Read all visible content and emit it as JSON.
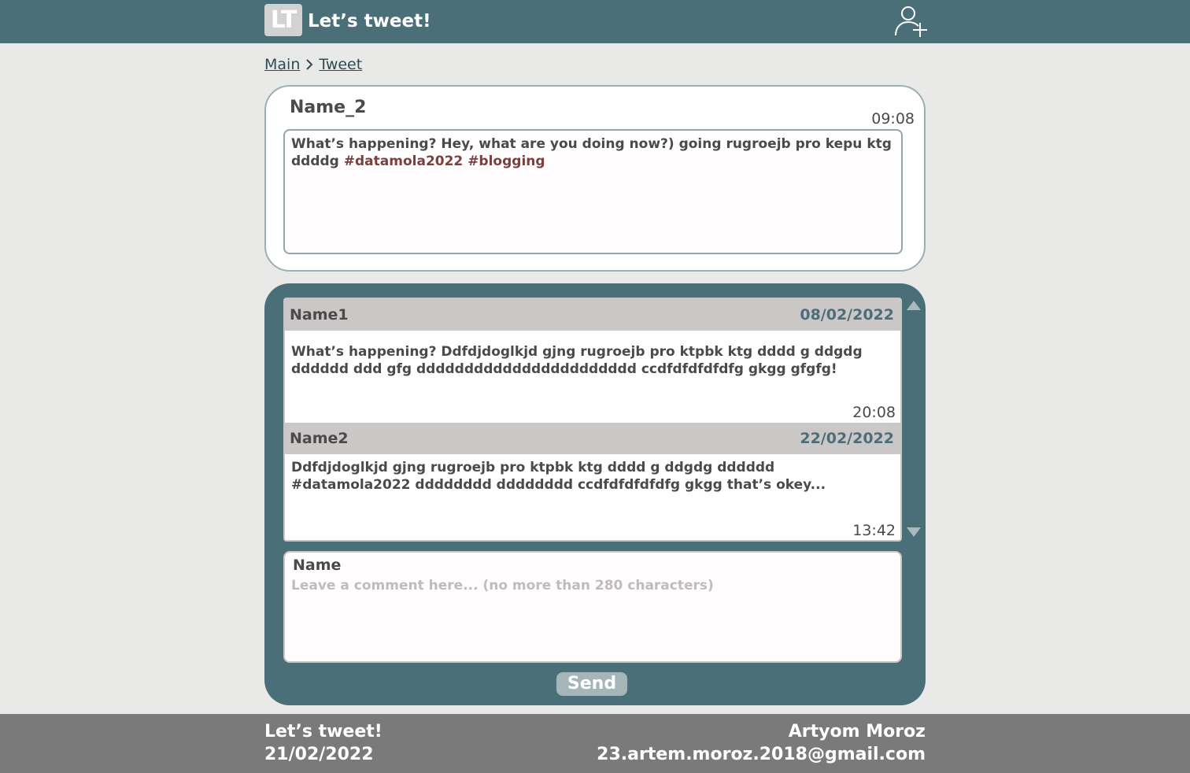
{
  "header": {
    "logo_text": "LT",
    "title": "Let’s tweet!",
    "add_user_icon": "user-plus-icon"
  },
  "breadcrumb": {
    "items": [
      "Main",
      "Tweet"
    ],
    "separator_icon": "chevron-right-icon"
  },
  "tweet": {
    "author": "Name_2",
    "time": "09:08",
    "text": "What’s happening? Hey, what are you doing now?) going rugroejb  pro kepu ktg ddddg ",
    "hashtags": [
      "#datamola2022",
      "#blogging"
    ]
  },
  "comments": [
    {
      "author": "Name1",
      "date": "08/02/2022",
      "text": "What’s happening?  Ddfdjdoglkjd gjng rugroejb  pro ktpbk ktg dddd g ddgdg dddddd ddd gfg ddddddddddddddddddddddd ccdfdfdfdfdfg gkgg gfgfg!",
      "time": "20:08"
    },
    {
      "author": "Name2",
      "date": "22/02/2022",
      "text": "Ddfdjdoglkjd gjng rugroejb  pro ktpbk ktg dddd g ddgdg dddddd #datamola2022  dddddddd dddddddd ccdfdfdfdfdfg gkgg that’s okey...",
      "time": "13:42"
    }
  ],
  "comment_form": {
    "name": "Name",
    "placeholder": "Leave a comment here... (no more than 280 characters)",
    "value": "",
    "send_label": "Send"
  },
  "footer": {
    "app_name": "Let’s tweet!",
    "date": "21/02/2022",
    "author": "Artyom Moroz",
    "email": "23.artem.moroz.2018@gmail.com"
  },
  "colors": {
    "header_bg": "#4b6f79",
    "panel_bg": "#4b6f79",
    "footer_bg": "#7a7a7a",
    "hashtag": "#7a3f3f",
    "date_accent": "#4b6f79"
  }
}
